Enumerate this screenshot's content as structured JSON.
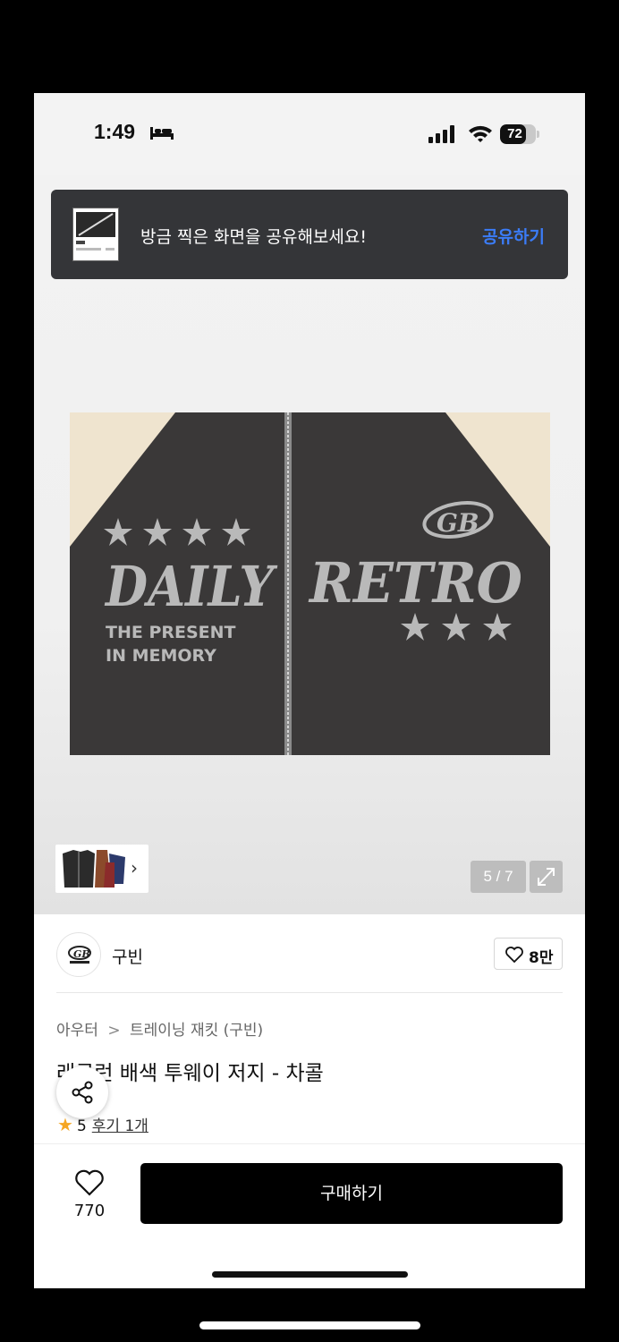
{
  "status_bar": {
    "time": "1:49",
    "battery": "72",
    "battery_level": 0.72
  },
  "toast": {
    "message": "방금 찍은 화면을 공유해보세요!",
    "action": "공유하기"
  },
  "gallery": {
    "print": {
      "line1": "DAILY",
      "line2": "RETRO",
      "sub1": "THE PRESENT",
      "sub2": "IN MEMORY",
      "logo": "GB"
    },
    "counter": "5 / 7",
    "thumbs_chevron": "›"
  },
  "brand": {
    "name": "구빈",
    "likes": "8만"
  },
  "breadcrumb": {
    "items": [
      "아우터",
      "트레이닝 재킷 (구빈)"
    ],
    "sep": ">"
  },
  "product": {
    "title": "래글런 배색 투웨이 저지 - 차콜",
    "rating": "5",
    "reviews": "후기 1개"
  },
  "bottom_bar": {
    "wish_count": "770",
    "buy_label": "구매하기"
  },
  "colors": {
    "accent_blue": "#3b7cf7",
    "buy_button": "#000000",
    "star": "#f5a623",
    "jacket": "#3a3838",
    "sleeve": "#efe4cf"
  },
  "icons": [
    "bed-icon",
    "cellular-icon",
    "wifi-icon",
    "battery-icon",
    "share-icon",
    "heart-icon",
    "expand-icon",
    "chevron-right-icon",
    "star-icon"
  ]
}
